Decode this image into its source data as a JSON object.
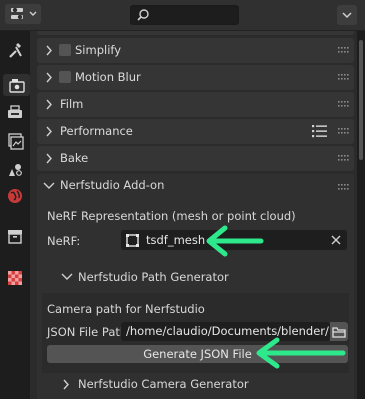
{
  "panels": [
    {
      "label": "Simplify",
      "checkbox": true
    },
    {
      "label": "Motion Blur",
      "checkbox": true
    },
    {
      "label": "Film",
      "checkbox": false
    },
    {
      "label": "Performance",
      "checkbox": false
    },
    {
      "label": "Bake",
      "checkbox": false
    }
  ],
  "addon": {
    "title": "Nerfstudio Add-on",
    "nerf_desc": "NeRF Representation (mesh or point cloud)",
    "nerf_label": "NeRF:",
    "nerf_value": "tsdf_mesh",
    "path_gen_title": "Nerfstudio Path Generator",
    "camera_path_label": "Camera path for Nerfstudio",
    "json_label": "JSON File Path:",
    "json_value": "/home/claudio/Documents/blender/",
    "generate_button": "Generate JSON File",
    "camera_gen_title": "Nerfstudio Camera Generator"
  },
  "colors": {
    "annotation_arrow": "#2ee88c",
    "red_tab_icon": "#d84040"
  },
  "icons": {
    "editor_type": "properties-editor-icon",
    "search": "search-icon",
    "tabs": [
      "tool-icon",
      "render-icon",
      "output-icon",
      "view-layer-icon",
      "scene-icon",
      "world-icon",
      "collection-icon",
      "texture-icon"
    ]
  }
}
